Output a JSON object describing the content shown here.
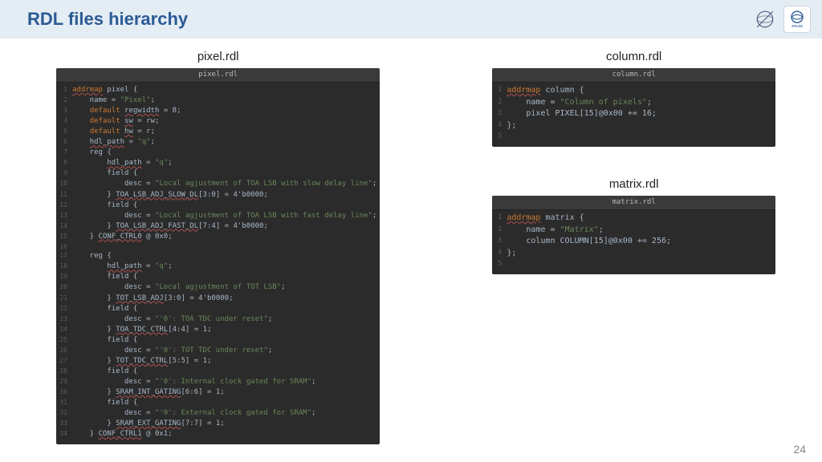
{
  "header": {
    "title": "RDL files hierarchy"
  },
  "pagenum": "24",
  "files": {
    "pixel": {
      "label": "pixel.rdl",
      "tab": "pixel.rdl",
      "lines": [
        {
          "n": "1",
          "c": "kw",
          "t": "addrmap",
          "r": " pixel {"
        },
        {
          "n": "2",
          "i": "    ",
          "t": "name = ",
          "s": "\"Pixel\"",
          "r2": ";"
        },
        {
          "n": "3",
          "i": "    ",
          "k": "default",
          "t": " ",
          "e": "regwidth",
          "r": " = 8;"
        },
        {
          "n": "4",
          "i": "    ",
          "k": "default",
          "t": " ",
          "e": "sw",
          "r": " = rw;"
        },
        {
          "n": "5",
          "i": "    ",
          "k": "default",
          "t": " ",
          "e": "hw",
          "r": " = r;"
        },
        {
          "n": "6",
          "i": "    ",
          "e": "hdl_path",
          "r": " = ",
          "s": "\"q\"",
          "r2": ";"
        },
        {
          "n": "7",
          "i": "    ",
          "t": "reg {"
        },
        {
          "n": "8",
          "i": "        ",
          "e": "hdl_path",
          "r": " = ",
          "s": "\"q\"",
          "r2": ";"
        },
        {
          "n": "9",
          "i": "        ",
          "t": "field {"
        },
        {
          "n": "10",
          "i": "            ",
          "t": "desc = ",
          "s": "\"Local agjustment of TOA LSB with slow delay line\"",
          "r2": ";"
        },
        {
          "n": "11",
          "i": "        ",
          "t": "} ",
          "e": "TOA_LSB_ADJ_SLOW_DL",
          "r": "[3:0] = 4'b0000;"
        },
        {
          "n": "12",
          "i": "        ",
          "t": "field {"
        },
        {
          "n": "13",
          "i": "            ",
          "t": "desc = ",
          "s": "\"Local agjustment of TOA LSB with fast delay line\"",
          "r2": ";"
        },
        {
          "n": "14",
          "i": "        ",
          "t": "} ",
          "e": "TOA_LSB_ADJ_FAST_DL",
          "r": "[7:4] = 4'b0000;"
        },
        {
          "n": "15",
          "i": "    ",
          "t": "} ",
          "e": "CONF_CTRL0",
          "r": " @ 0x0;"
        },
        {
          "n": "16",
          "i": "",
          "t": ""
        },
        {
          "n": "17",
          "i": "    ",
          "t": "reg {"
        },
        {
          "n": "18",
          "i": "        ",
          "e": "hdl_path",
          "r": " = ",
          "s": "\"q\"",
          "r2": ";"
        },
        {
          "n": "19",
          "i": "        ",
          "t": "field {"
        },
        {
          "n": "20",
          "i": "            ",
          "t": "desc = ",
          "s": "\"Local agjustment of TOT LSB\"",
          "r2": ";"
        },
        {
          "n": "21",
          "i": "        ",
          "t": "} ",
          "e": "TOT_LSB_ADJ",
          "r": "[3:0] = 4'b0000;"
        },
        {
          "n": "22",
          "i": "        ",
          "t": "field {"
        },
        {
          "n": "23",
          "i": "            ",
          "t": "desc = ",
          "s": "\"'0': TOA TDC under reset\"",
          "r2": ";"
        },
        {
          "n": "24",
          "i": "        ",
          "t": "} ",
          "e": "TOA_TDC_CTRL",
          "r": "[4:4] = 1;"
        },
        {
          "n": "25",
          "i": "        ",
          "t": "field {"
        },
        {
          "n": "26",
          "i": "            ",
          "t": "desc = ",
          "s": "\"'0': TOT TDC under reset\"",
          "r2": ";"
        },
        {
          "n": "27",
          "i": "        ",
          "t": "} ",
          "e": "TOT_TDC_CTRL",
          "r": "[5:5] = 1;"
        },
        {
          "n": "28",
          "i": "        ",
          "t": "field {"
        },
        {
          "n": "29",
          "i": "            ",
          "t": "desc = ",
          "s": "\"'0': Internal clock gated for SRAM\"",
          "r2": ";"
        },
        {
          "n": "30",
          "i": "        ",
          "t": "} ",
          "e": "SRAM_INT_GATING",
          "r": "[6:6] = 1;"
        },
        {
          "n": "31",
          "i": "        ",
          "t": "field {"
        },
        {
          "n": "32",
          "i": "            ",
          "t": "desc = ",
          "s": "\"'0': External clock gated for SRAM\"",
          "r2": ";"
        },
        {
          "n": "33",
          "i": "        ",
          "t": "} ",
          "e": "SRAM_EXT_GATING",
          "r": "[7:7] = 1;"
        },
        {
          "n": "34",
          "i": "    ",
          "t": "} ",
          "e": "CONF_CTRL1",
          "r": " @ 0x1;"
        }
      ]
    },
    "column": {
      "label": "column.rdl",
      "tab": "column.rdl",
      "lines": [
        {
          "n": "1",
          "c": "kw",
          "t": "addrmap",
          "r": " column {"
        },
        {
          "n": "2",
          "i": "    ",
          "t": "name = ",
          "s": "\"Column of pixels\"",
          "r2": ";"
        },
        {
          "n": "3",
          "i": "    ",
          "t": "pixel PIXEL[15]@0x00 += 16;"
        },
        {
          "n": "4",
          "i": "",
          "t": "};"
        },
        {
          "n": "5",
          "i": "",
          "t": ""
        }
      ]
    },
    "matrix": {
      "label": "matrix.rdl",
      "tab": "matrix.rdl",
      "lines": [
        {
          "n": "1",
          "c": "kw",
          "t": "addrmap",
          "r": " matrix {"
        },
        {
          "n": "2",
          "i": "    ",
          "t": "name = ",
          "s": "\"Matrix\"",
          "r2": ";"
        },
        {
          "n": "3",
          "i": "    ",
          "t": "column COLUMN[15]@0x00 += 256;"
        },
        {
          "n": "4",
          "i": "",
          "t": "};"
        },
        {
          "n": "5",
          "i": "",
          "t": ""
        }
      ]
    }
  }
}
